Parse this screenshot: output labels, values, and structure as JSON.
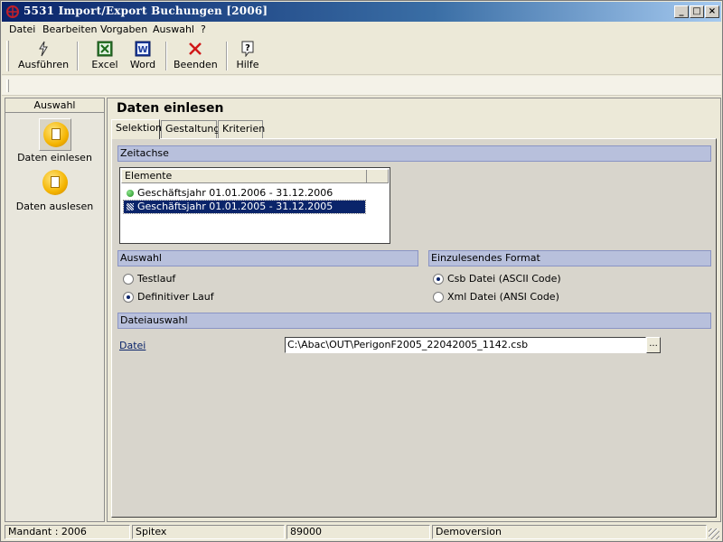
{
  "window": {
    "title": "5531 Import/Export Buchungen [2006]",
    "min": "_",
    "max": "□",
    "close": "×"
  },
  "menu": [
    "Datei",
    "Bearbeiten",
    "Vorgaben",
    "Auswahl",
    "?"
  ],
  "toolbar": {
    "run": "Ausführen",
    "excel": "Excel",
    "word": "Word",
    "quit": "Beenden",
    "help": "Hilfe"
  },
  "sidebar": {
    "header": "Auswahl",
    "items": [
      {
        "label": "Daten einlesen",
        "selected": true
      },
      {
        "label": "Daten auslesen",
        "selected": false
      }
    ]
  },
  "main": {
    "heading": "Daten einlesen",
    "tabs": [
      {
        "label": "Selektion",
        "active": true
      },
      {
        "label": "Gestaltung",
        "active": false
      },
      {
        "label": "Kriterien",
        "active": false
      }
    ],
    "zeitachse": {
      "title": "Zeitachse",
      "column": "Elemente",
      "rows": [
        {
          "label": "Geschäftsjahr 01.01.2006 - 31.12.2006",
          "selected": false
        },
        {
          "label": "Geschäftsjahr 01.01.2005 - 31.12.2005",
          "selected": true
        }
      ]
    },
    "auswahl": {
      "title": "Auswahl",
      "options": [
        {
          "label": "Testlauf",
          "checked": false
        },
        {
          "label": "Definitiver Lauf",
          "checked": true
        }
      ]
    },
    "format": {
      "title": "Einzulesendes Format",
      "options": [
        {
          "label": "Csb Datei (ASCII Code)",
          "checked": true
        },
        {
          "label": "Xml Datei (ANSI Code)",
          "checked": false
        }
      ]
    },
    "dateiauswahl": {
      "title": "Dateiauswahl",
      "file_label": "Datei",
      "file_value": "C:\\Abac\\OUT\\PerigonF2005_22042005_1142.csb",
      "browse": "..."
    }
  },
  "status": [
    "Mandant : 2006",
    "Spitex",
    "89000",
    "Demoversion"
  ],
  "colors": {
    "accent": "#0a246a",
    "section": "#b8c0dc",
    "icon": "#f4b400"
  }
}
